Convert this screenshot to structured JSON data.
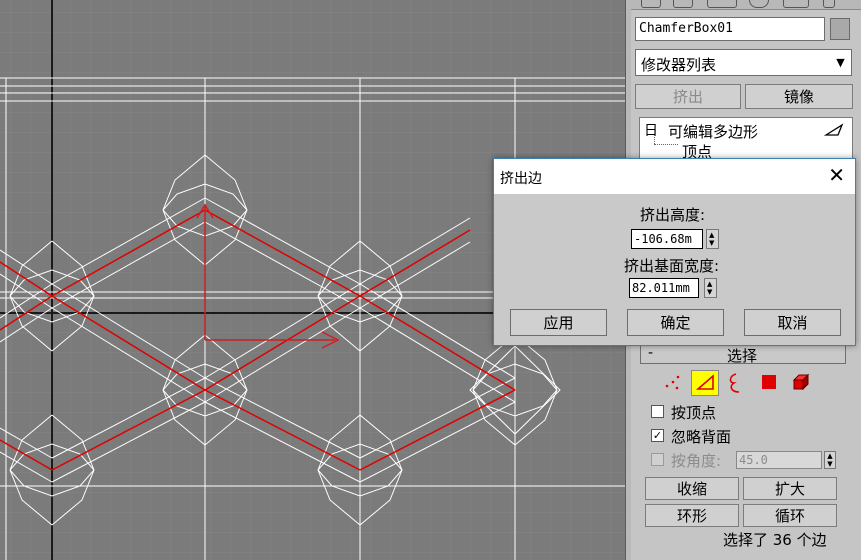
{
  "panel": {
    "object_name": "ChamferBox01",
    "modifier_list_placeholder": "修改器列表",
    "extrude_button": "挤出",
    "mirror_button": "镜像",
    "stack": {
      "expand_symbol": "日",
      "editable_poly": "可编辑多边形",
      "vertex": "顶点"
    },
    "selection_rollout": {
      "collapse_symbol": "-",
      "title": "选择",
      "by_vertex": "按顶点",
      "by_vertex_checked": false,
      "ignore_backfacing": "忽略背面",
      "ignore_backfacing_checked": true,
      "by_angle": "按角度:",
      "by_angle_value": "45.0",
      "shrink": "收缩",
      "grow": "扩大",
      "ring": "环形",
      "loop": "循环",
      "selection_status": "选择了 36 个边"
    },
    "subobject_icons": [
      "vertex-icon",
      "edge-icon",
      "border-icon",
      "polygon-icon",
      "element-icon"
    ],
    "accent_color": "#ffff00"
  },
  "dialog": {
    "title": "挤出边",
    "close_symbol": "✕",
    "height_label": "挤出高度:",
    "height_value": "-106.68m",
    "base_width_label": "挤出基面宽度:",
    "base_width_value": "82.011mm",
    "apply": "应用",
    "ok": "确定",
    "cancel": "取消"
  },
  "viewport": {
    "wire_color": "#ffffff",
    "selected_edge_color": "#e00000",
    "background": "#7b7b7b"
  }
}
